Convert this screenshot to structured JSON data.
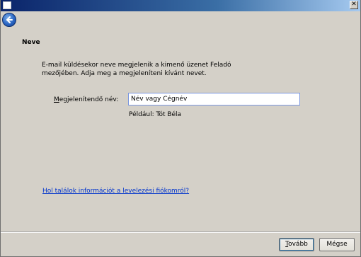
{
  "window": {
    "close_glyph": "✕"
  },
  "section": {
    "title": "Neve",
    "description": "E-mail küldésekor neve megjelenik a kimenő üzenet Feladó mezőjében. Adja meg a megjeleníteni kívánt nevet."
  },
  "form": {
    "label_prefix": "M",
    "label_rest": "egjelenítendő név:",
    "name_value": "Név vagy Cégnév",
    "example": "Például: Tót Béla"
  },
  "help": {
    "link_text": "Hol találok információt a levelezési fiókomról?"
  },
  "buttons": {
    "next_prefix": "T",
    "next_rest": "ovább",
    "cancel": "Mégse"
  },
  "colors": {
    "accent": "#0a246a",
    "link": "#0033cc"
  },
  "icons": {
    "back": "back-arrow-icon",
    "system": "window-icon",
    "close": "close-icon"
  }
}
